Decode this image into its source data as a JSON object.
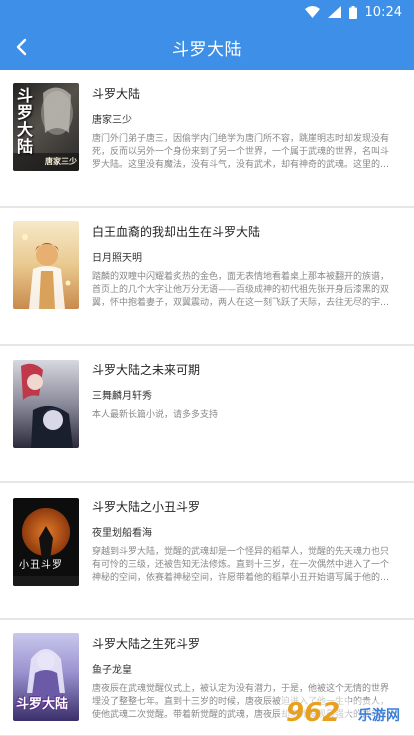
{
  "status": {
    "time": "10:24"
  },
  "header": {
    "title": "斗罗大陆",
    "back_icon": "chevron-left-icon"
  },
  "books": [
    {
      "title": "斗罗大陆",
      "author": "唐家三少",
      "desc": "唐门外门弟子唐三，因偷学内门绝学为唐门所不容，跳崖明志时却发现没有死，反而以另外一个身份来到了另一个世界，一个属于武魂的世界，名叫斗罗大陆。这里没有魔法，没有斗气，没有武术，却有神奇的武魂。这里的每个人，在自己六岁的时候，都会在武魂殿中令武魂觉醒。",
      "cover_text": [
        "斗",
        "罗",
        "大",
        "陆"
      ],
      "cover_caption": "唐家三少"
    },
    {
      "title": "白王血裔的我却出生在斗罗大陆",
      "author": "日月照天明",
      "desc": "踏麟的双瞳中闪耀着炙热的金色，面无表情地看着桌上那本被翻开的族谱，首页上的几个大字让他万分无语——百级成神的初代祖先张开身后漆黑的双翼，怀中抱着妻子，双翼震动，两人在这一刻飞跃了天际，去往无尽的宇宙，踏上了那未完成的旅行——记伟大的..."
    },
    {
      "title": "斗罗大陆之未来可期",
      "author": "三舞麟月轩秀",
      "desc": "本人最新长篇小说，请多多支持"
    },
    {
      "title": "斗罗大陆之小丑斗罗",
      "author": "夜里划船看海",
      "desc": "穿越到斗罗大陆，觉醒的武魂却是一个怪异的稻草人，觉醒的先天魂力也只有可怜的三级，还被告知无法修炼。直到十三岁，在一次偶然中进入了一个神秘的空间，依赛着神秘空间，许愿带着他的稻草小丑开始谱写属于他的传奇。神奇的礼盒中带着极端的惊喜，",
      "cover_text": "小丑斗罗"
    },
    {
      "title": "斗罗大陆之生死斗罗",
      "author": "鱼子龙皇",
      "desc": "唐夜辰在武魂觉醒仪式上，被认定为没有潜力，于是，他被这个无情的世界埋没了整整七年。直到十三岁的时候，唐夜辰被迫进入了他一生中的贵人，使他武魂二次觉醒。带着新觉醒的武魂，唐夜辰却意外发现最强大的武魂却是那个一直被埋没的..",
      "cover_text": "斗罗大陆"
    }
  ],
  "watermark": {
    "text": "962",
    "sub": "乐游网"
  }
}
